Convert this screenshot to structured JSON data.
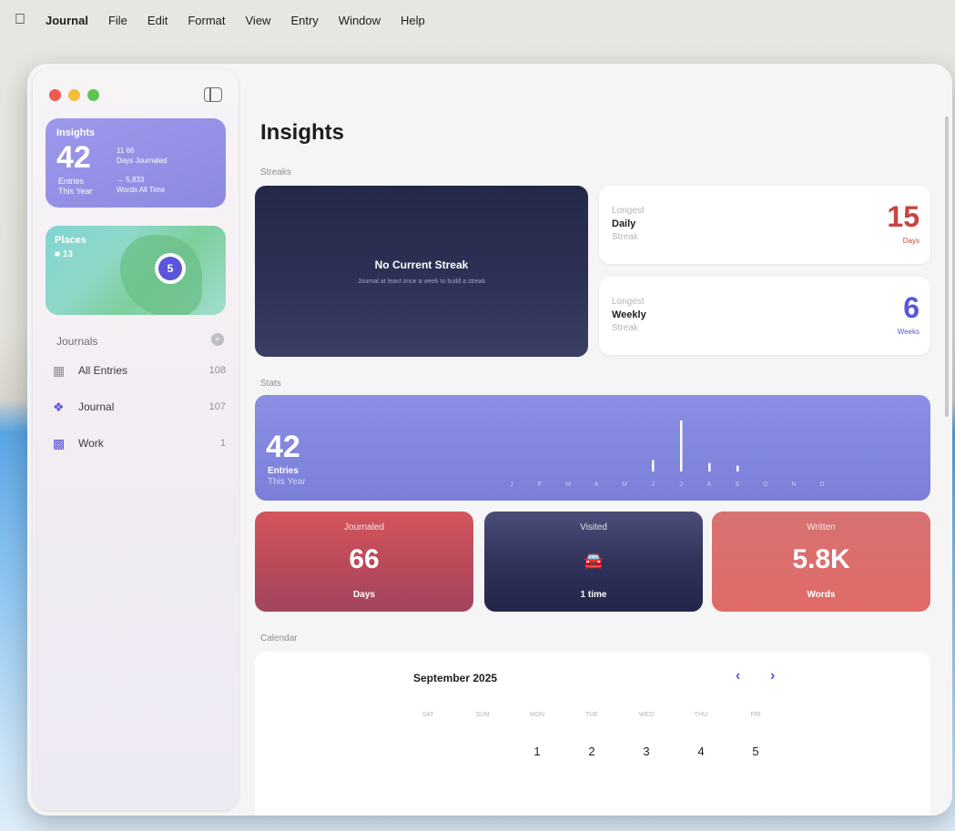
{
  "menubar": {
    "app": "Journal",
    "items": [
      "File",
      "Edit",
      "Format",
      "View",
      "Entry",
      "Window",
      "Help"
    ]
  },
  "sidebar": {
    "insights_card": {
      "title": "Insights",
      "entries_count": "42",
      "entries_label": "Entries",
      "entries_period": "This Year",
      "days_line1": "11 66",
      "days_line2": "Days Journaled",
      "words_line1": "→ 5,833",
      "words_line2": "Words All Time"
    },
    "places_card": {
      "title": "Places",
      "count": "■ 13",
      "pin_count": "5"
    },
    "journals_header": "Journals",
    "journals": [
      {
        "label": "All Entries",
        "count": "108",
        "icon": "grid-icon",
        "color": "#8e8e93"
      },
      {
        "label": "Journal",
        "count": "107",
        "icon": "butterfly-icon",
        "color": "#5b55d9"
      },
      {
        "label": "Work",
        "count": "1",
        "icon": "map-icon",
        "color": "#5b55d9"
      }
    ]
  },
  "main": {
    "title": "Insights",
    "streaks_label": "Streaks",
    "current_streak": {
      "headline": "No Current Streak",
      "subtitle": "Journal at least once a week to build a streak"
    },
    "longest_daily": {
      "line1": "Longest",
      "line2": "Daily",
      "line3": "Streak",
      "value": "15",
      "unit": "Days",
      "color": "#c9443f"
    },
    "longest_weekly": {
      "line1": "Longest",
      "line2": "Weekly",
      "line3": "Streak",
      "value": "6",
      "unit": "Weeks",
      "color": "#5b55d9"
    },
    "stats_label": "Stats",
    "stats": {
      "entries_count": "42",
      "entries_label": "Entries",
      "entries_period": "This Year",
      "months": [
        "J",
        "F",
        "M",
        "A",
        "M",
        "J",
        "J",
        "A",
        "S",
        "O",
        "N",
        "D"
      ],
      "monthly_values": [
        0,
        0,
        0,
        0,
        0,
        4,
        18,
        3,
        2,
        0,
        0,
        0
      ]
    },
    "tiles": {
      "journaled": {
        "title": "Journaled",
        "value": "66",
        "unit": "Days"
      },
      "visited": {
        "title": "Visited",
        "unit": "1 time",
        "icon": "car-icon"
      },
      "written": {
        "title": "Written",
        "value": "5.8K",
        "unit": "Words"
      }
    },
    "calendar_label": "Calendar",
    "calendar": {
      "month": "September 2025",
      "weekdays": [
        "SAT",
        "SUN",
        "MON",
        "TUE",
        "WED",
        "THU",
        "FRI"
      ],
      "days": [
        "1",
        "2",
        "3",
        "4",
        "5"
      ]
    }
  }
}
